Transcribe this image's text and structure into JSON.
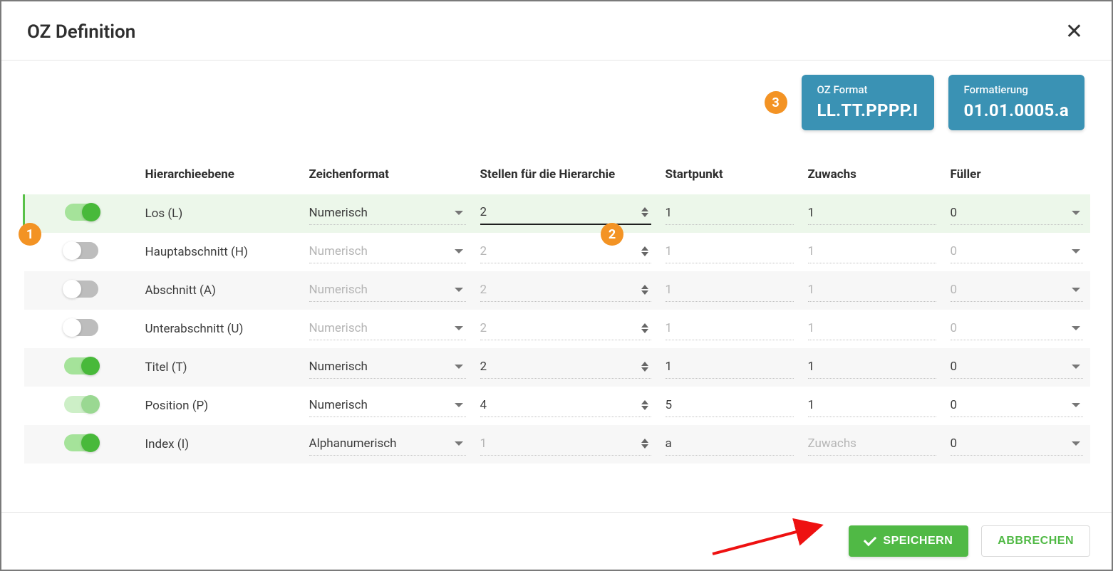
{
  "modal": {
    "title": "OZ Definition"
  },
  "info": {
    "badge3": "3",
    "format_label": "OZ Format",
    "format_value": "LL.TT.PPPP.I",
    "formatting_label": "Formatierung",
    "formatting_value": "01.01.0005.a"
  },
  "headers": {
    "hier": "Hierarchieebene",
    "fmt": "Zeichenformat",
    "stellen": "Stellen für die Hierarchie",
    "start": "Startpunkt",
    "zuw": "Zuwachs",
    "full": "Füller"
  },
  "rows": [
    {
      "enabled": true,
      "faded": false,
      "name": "Los (L)",
      "fmt": "Numerisch",
      "stellen": "2",
      "start": "1",
      "zuw": "1",
      "full": "0"
    },
    {
      "enabled": false,
      "faded": false,
      "name": "Hauptabschnitt (H)",
      "fmt": "Numerisch",
      "stellen": "2",
      "start": "1",
      "zuw": "1",
      "full": "0"
    },
    {
      "enabled": false,
      "faded": false,
      "name": "Abschnitt (A)",
      "fmt": "Numerisch",
      "stellen": "2",
      "start": "1",
      "zuw": "1",
      "full": "0"
    },
    {
      "enabled": false,
      "faded": false,
      "name": "Unterabschnitt (U)",
      "fmt": "Numerisch",
      "stellen": "2",
      "start": "1",
      "zuw": "1",
      "full": "0"
    },
    {
      "enabled": true,
      "faded": false,
      "name": "Titel (T)",
      "fmt": "Numerisch",
      "stellen": "2",
      "start": "1",
      "zuw": "1",
      "full": "0"
    },
    {
      "enabled": true,
      "faded": true,
      "name": "Position (P)",
      "fmt": "Numerisch",
      "stellen": "4",
      "start": "5",
      "zuw": "1",
      "full": "0"
    },
    {
      "enabled": true,
      "faded": false,
      "name": "Index (I)",
      "fmt": "Alphanumerisch",
      "stellen": "1",
      "start": "a",
      "zuw": "",
      "full": "0",
      "zuw_placeholder": "Zuwachs",
      "stellen_disabled": true
    }
  ],
  "annotations": {
    "badge1": "1",
    "badge2": "2"
  },
  "footer": {
    "save": "SPEICHERN",
    "cancel": "ABBRECHEN"
  }
}
